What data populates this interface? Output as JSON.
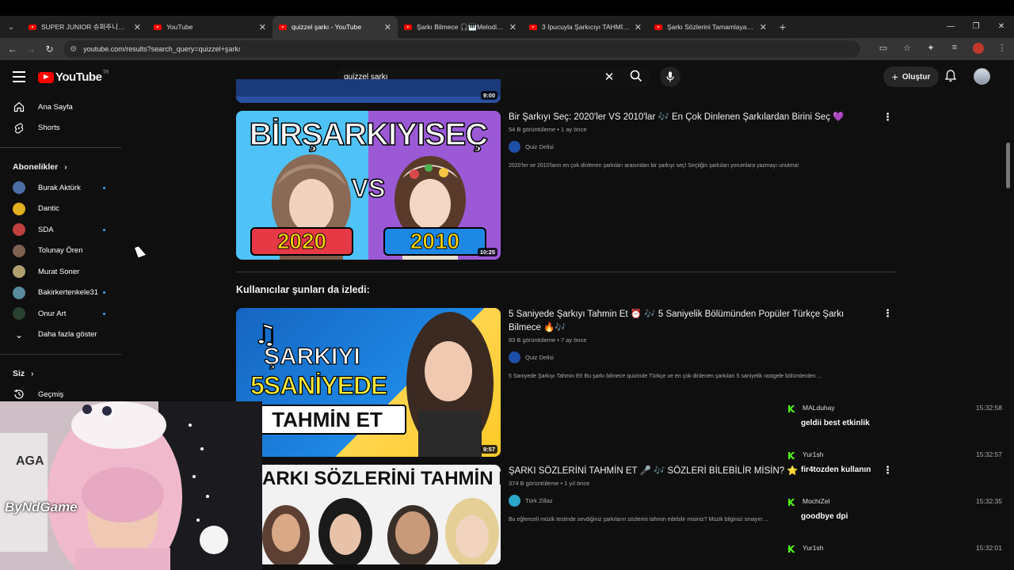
{
  "browser": {
    "tabs": [
      {
        "label": "SUPER JUNIOR 슈퍼주니어 'Se...",
        "active": false
      },
      {
        "label": "YouTube",
        "active": false
      },
      {
        "label": "quizzel şarkı - YouTube",
        "active": true
      },
      {
        "label": "Şarkı Bilmece 🎧🎹Melodilerin...",
        "active": false
      },
      {
        "label": "3 İpucuyla Şarkıcıyı TAHMİN ET...",
        "active": false
      },
      {
        "label": "Şarkı Sözlerini Tamamlayabilir mi...",
        "active": false
      }
    ],
    "url": "youtube.com/results?search_query=quizzel+şarkı"
  },
  "header": {
    "logo_text": "YouTube",
    "logo_region": "TR",
    "search_query": "quizzel şarkı",
    "create_label": "Oluştur"
  },
  "sidebar": {
    "home": "Ana Sayfa",
    "shorts": "Shorts",
    "subscriptions_title": "Abonelikler",
    "channels": [
      {
        "name": "Burak Aktürk",
        "live": true,
        "color": "#4a6fa5"
      },
      {
        "name": "Dantic",
        "live": false,
        "color": "#e0b020"
      },
      {
        "name": "SDA",
        "live": true,
        "color": "#c04040"
      },
      {
        "name": "Tolunay Ören",
        "live": false,
        "color": "#806050"
      },
      {
        "name": "Murat Soner",
        "live": false,
        "color": "#b0a070"
      },
      {
        "name": "Bakirkertenkele31",
        "live": true,
        "color": "#5a8aa0"
      },
      {
        "name": "Onur Art",
        "live": true,
        "color": "#2a4030"
      }
    ],
    "show_more": "Daha fazla göster",
    "you_title": "Siz",
    "history": "Geçmiş"
  },
  "videos": [
    {
      "title": "Bir Şarkıyı Seç: 2020'ler VS 2010'lar 🎶 En Çok Dinlenen Şarkılardan Birini Seç 💜",
      "meta": "54 B görüntüleme • 1 ay önce",
      "channel": "Quiz Delisi",
      "description": "2020'ler ve 2010'ların en çok dinlenen şarkıları arasından bir şarkıyı seç! Seçtiğin şarkıları yorumlara yazmayı unutma!",
      "duration": "10:25",
      "thumb_top_text": "BİRŞARKIYISEÇ",
      "thumb_vs": "VS",
      "thumb_left_year": "2020",
      "thumb_right_year": "2010"
    },
    {
      "title": "5 Saniyede Şarkıyı Tahmin Et ⏰ 🎶 5 Saniyelik Bölümünden Popüler Türkçe Şarkı Bilmece 🔥🎶",
      "meta": "83 B görüntüleme • 7 ay önce",
      "channel": "Quiz Delisi",
      "description": "5 Saniyede Şarkıyı Tahmin Et! Bu şarkı bilmece quizinde Türkçe ve en çok dinlenen şarkıları 5 saniyelik rastgele bölümlerden ...",
      "duration": "9:57",
      "thumb_line1": "ŞARKIYI",
      "thumb_line2": "5SANİYEDE",
      "thumb_line3": "TAHMİN ET"
    },
    {
      "title": "ŞARKI SÖZLERİNİ TAHMİN ET 🎤 🎶 SÖZLERİ BİLEBİLİR MİSİN? ⭐",
      "meta": "374 B görüntüleme • 1 yıl önce",
      "channel": "Türk Zillaz",
      "description": "Bu eğlenceli müzik testinde sevdiğiniz şarkıların sözlerini tahmin edebilir misiniz? Müzik bilginizi sınayın ...",
      "thumb_text": "ARKI SÖZLERİNİ TAHMİN ET!"
    }
  ],
  "prev_duration": "9:00",
  "related_section_title": "Kullanıcılar şunları da izledi:",
  "webcam": {
    "watermark": "ByNdGame",
    "shirt_text": "AGA"
  },
  "chat": [
    {
      "user": "MALduhay",
      "time": "15:32:58",
      "message": "geldii best etkinlik"
    },
    {
      "user": "Yur1sh",
      "time": "15:32:57",
      "message": "fir4tozden kullanın"
    },
    {
      "user": "MochiZel",
      "time": "15:32:35",
      "message": "goodbye dpi"
    },
    {
      "user": "Yur1sh",
      "time": "15:32:01",
      "message": ""
    }
  ]
}
